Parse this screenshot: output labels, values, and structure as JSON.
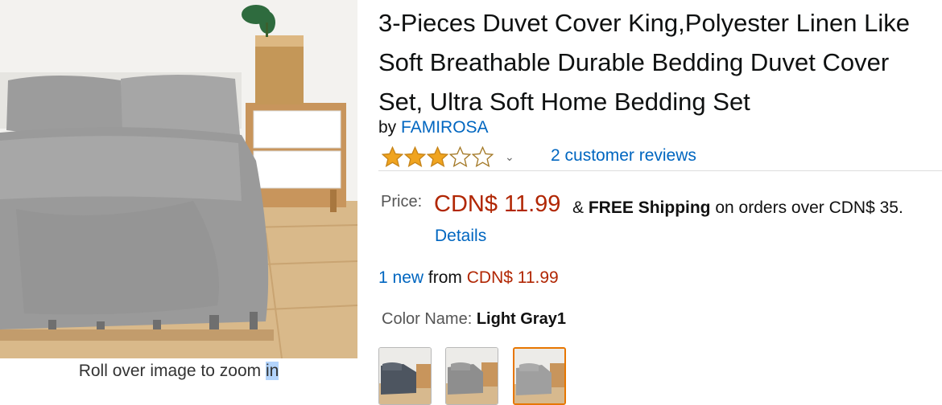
{
  "product": {
    "title": "3-Pieces Duvet Cover King,Polyester Linen Like Soft Breathable Durable Bedding Duvet Cover Set, Ultra Soft Home Bedding Set",
    "by_prefix": "by",
    "brand": "FAMIROSA"
  },
  "rating": {
    "stars": 3,
    "max_stars": 5,
    "reviews_link": "2 customer reviews",
    "star_color": "#f0a41f"
  },
  "price": {
    "label": "Price:",
    "value": "CDN$ 11.99",
    "shipping_connector": "&",
    "shipping_bold": "FREE Shipping",
    "shipping_rest": "on orders over CDN$ 35.",
    "details_link": "Details"
  },
  "offers": {
    "count_link": "1 new",
    "from_text": "from",
    "price": "CDN$ 11.99"
  },
  "color": {
    "label": "Color Name:",
    "selected": "Light Gray1",
    "swatches": [
      {
        "name": "dark-gray",
        "selected": false
      },
      {
        "name": "gray",
        "selected": false
      },
      {
        "name": "light-gray",
        "selected": true
      }
    ]
  },
  "image": {
    "zoom_hint_before": "Roll over image to zoom ",
    "zoom_hint_highlight": "in"
  },
  "colors": {
    "link": "#0066c0",
    "price": "#b12704",
    "swatch_selected_border": "#e77600"
  }
}
